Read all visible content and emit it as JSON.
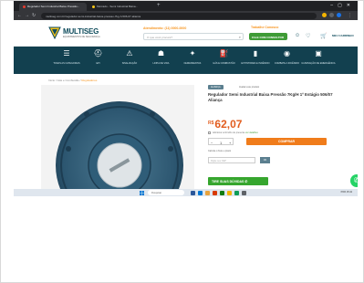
{
  "browser": {
    "tabs": [
      {
        "label": "Regulador Semi Industrial Baixa Pressão..."
      },
      {
        "label": "Mercado - Semi Industrial Baixa..."
      }
    ],
    "url": "multiseg.com.br/regulador-semi-industrial-baixa-pressao-7kg-h-506-07-alianca"
  },
  "header": {
    "brand": "MULTISEG",
    "brand_tagline": "EQUIPAMENTOS DE SEGURANÇA",
    "atendimento": "Atendimento: (11) 0000-0000",
    "search_placeholder": "O que você procura?",
    "trabalhe": "Trabalhe Conosco",
    "consultor": "FALE COM CONSULTOR",
    "cart_label": "MEU CARRINHO"
  },
  "categories": [
    {
      "icon": "menu-icon",
      "label": "Todas as Categorias"
    },
    {
      "icon": "epi-icon",
      "label": "EPI"
    },
    {
      "icon": "warning-icon",
      "label": "Sinalização"
    },
    {
      "icon": "user-icon",
      "label": "Linha de Vida"
    },
    {
      "icon": "tool-icon",
      "label": "Ferramentas"
    },
    {
      "icon": "gas-icon",
      "label": "Gás e Combustão"
    },
    {
      "icon": "extinguisher-icon",
      "label": "Extintores e Incêndio"
    },
    {
      "icon": "hydrant-icon",
      "label": "Combate a Incêndio"
    },
    {
      "icon": "light-icon",
      "label": "Iluminação de Emergência"
    }
  ],
  "breadcrumb": {
    "path": "Início / Gás e Combustão / ",
    "current": "Reguladores"
  },
  "product": {
    "badge": "ALIANÇA",
    "badge_secondary": "Avaliar este produto",
    "title": "Regulador Semi Industrial Baixa Pressão 7Kg/H 1º Estágio 506/07 Aliança",
    "currency": "R$",
    "price": "62,07",
    "price_note": "à vista no boleto",
    "gift_option": "Adicionar embrulho de presente",
    "gift_link": "ver detalhes",
    "quantity": "1",
    "buy_label": "COMPRAR",
    "freight_label": "Calcule o frete e prazo",
    "cep_placeholder": "Digite seu CEP",
    "cep_button": "OK",
    "whatsapp_label": "TIRE SUAS DÚVIDAS"
  },
  "taskbar": {
    "search_placeholder": "Pesquisar",
    "tray_text": "POR 15:42"
  },
  "colors": {
    "nav_bg": "#12404f",
    "accent_orange": "#f07c1b",
    "price_orange": "#e25d1f",
    "green": "#3f9b36"
  }
}
